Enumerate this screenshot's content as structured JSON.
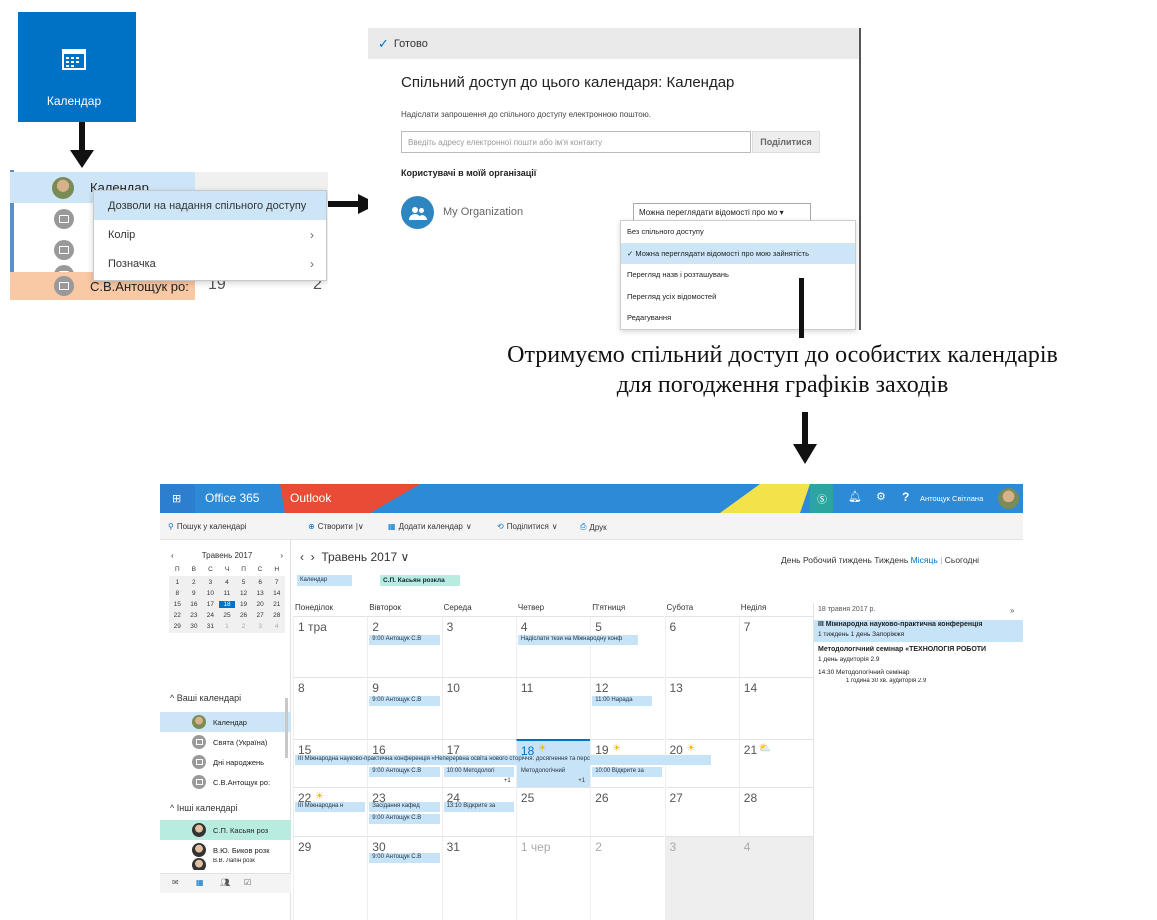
{
  "tile": {
    "label": "Календар",
    "icon": "calendar-icon",
    "color": "#0072c6"
  },
  "context": {
    "calendar_row": "Календар",
    "bottom_row": "С.В.Антощук ро:",
    "bottom_nums": [
      "19",
      "2"
    ],
    "menu": [
      {
        "label": "Дозволи на надання спільного доступу",
        "selected": true
      },
      {
        "label": "Колір",
        "chevron": "›"
      },
      {
        "label": "Позначка",
        "chevron": "›"
      }
    ]
  },
  "share": {
    "done": "Готово",
    "title": "Спільний доступ до цього календаря: Календар",
    "subtitle": "Надіслати запрошення до спільного доступу електронною поштою.",
    "email_placeholder": "Введіть адресу електронної пошти або ім'я контакту",
    "share_button": "Поділитися",
    "org_header": "Користувачі в моїй організації",
    "org_name": "My Organization",
    "permission_selected": "Можна переглядати відомості про мо ▾",
    "options": [
      {
        "label": "Без спільного доступу",
        "selected": false
      },
      {
        "label": "✓ Можна переглядати відомості про мою зайнятість",
        "selected": true
      },
      {
        "label": "Перегляд назв і розташувань",
        "selected": false
      },
      {
        "label": "Перегляд усіх відомостей",
        "selected": false
      },
      {
        "label": "Редагування",
        "selected": false
      }
    ]
  },
  "caption": {
    "line1": "Отримуємо спільний доступ до особистих календарів",
    "line2": "для погодження графіків заходів"
  },
  "outlook": {
    "brand": "Office 365",
    "app": "Outlook",
    "user": "Антощук Світлана",
    "search": "Пошук у календарі",
    "toolbar": {
      "create": "Створити",
      "add": "Додати календар",
      "share": "Поділитися",
      "print": "Друк"
    },
    "month_title": "Травень 2017",
    "chips": [
      "Календар",
      "С.П. Касьян розкла"
    ],
    "views": {
      "day": "День",
      "workweek": "Робочий тиждень",
      "week": "Тиждень",
      "month": "Місяць",
      "sep": "|",
      "today": "Сьогодні"
    },
    "mini_cal": {
      "month": "Травень 2017",
      "dow": [
        "П",
        "В",
        "С",
        "Ч",
        "П",
        "С",
        "Н"
      ],
      "days": [
        "1",
        "2",
        "3",
        "4",
        "5",
        "6",
        "7",
        "8",
        "9",
        "10",
        "11",
        "12",
        "13",
        "14",
        "15",
        "16",
        "17",
        "18",
        "19",
        "20",
        "21",
        "22",
        "23",
        "24",
        "25",
        "26",
        "27",
        "28",
        "29",
        "30",
        "31",
        "1",
        "2",
        "3",
        "4"
      ],
      "today": "18"
    },
    "your_calendars": "Ваші календарі",
    "other_calendars": "Інші календарі",
    "your_list": [
      "Календар",
      "Свята (Україна)",
      "Дні народжень",
      "С.В.Антощук ро:"
    ],
    "other_list": [
      "С.П. Касьян роз",
      "В.Ю. Биков розк",
      "В.В. Лапін розк"
    ],
    "weekdays": [
      "Понеділок",
      "Вівторок",
      "Середа",
      "Четвер",
      "П'ятниця",
      "Субота",
      "Неділя"
    ],
    "weeks": [
      [
        "1 тра",
        "2",
        "3",
        "4",
        "5",
        "6",
        "7"
      ],
      [
        "8",
        "9",
        "10",
        "11",
        "12",
        "13",
        "14"
      ],
      [
        "15",
        "16",
        "17",
        "18",
        "19",
        "20",
        "21"
      ],
      [
        "22",
        "23",
        "24",
        "25",
        "26",
        "27",
        "28"
      ],
      [
        "29",
        "30",
        "31",
        "1 чер",
        "2",
        "3",
        "4"
      ]
    ],
    "events": {
      "w1_tue": "9:00 Антощук С.В",
      "w1_thu": "Надіслати тези на Міжнародну конф",
      "w2_tue": "9:00 Антощук С.В",
      "w2_fri": "11:00 Нарада",
      "w3_bar": "III Міжнародна науково-практична конференція «Неперервна освіта нового сторіччя: досягнення та перс",
      "w3_tue": "9:00 Антощук С.В",
      "w3_wed": "10:00 Методологі",
      "w3_thu": "Методологічний",
      "w3_fri": "10:00 Відкрите за",
      "w3_plus_wed": "+1",
      "w3_plus_thu": "+1",
      "w4_mon": "III Міжнародна н",
      "w4_tue": "Засідання кафед",
      "w4_tue2": "9:00 Антощук С.В",
      "w4_wed": "13:10 Відкрите за",
      "w5_tue": "9:00 Антощук С.В"
    },
    "side": {
      "date": "18 травня 2017 р.",
      "arrows": "»",
      "e1": "III Міжнародна науково-практична конференція",
      "e1d": "1 тиждень 1 день Запоріжжя",
      "e2": "Методологічний семінар «ТЕХНОЛОГІЯ РОБОТИ",
      "e2d": "1 день аудиторія 2.9",
      "e3t": "14:30",
      "e3": "Методологічний семінар",
      "e3d": "1 година 30 хв. аудиторія 2.9"
    }
  }
}
